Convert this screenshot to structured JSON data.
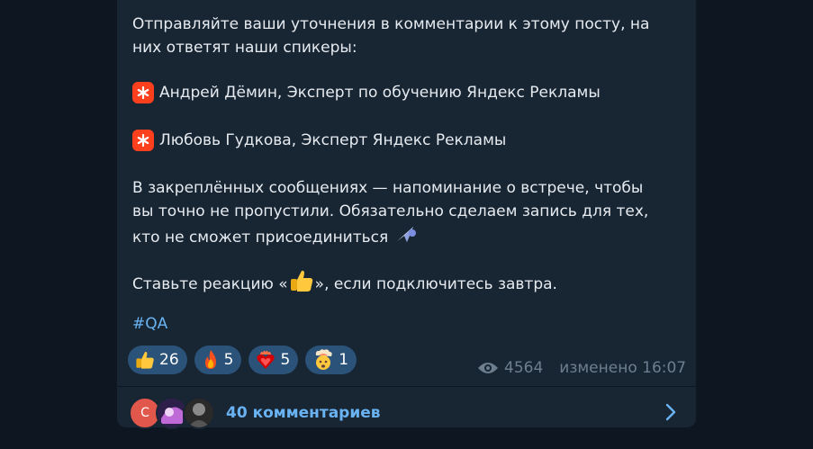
{
  "message": {
    "intro": [
      "Отправляйте ваши уточнения в комментарии к этому посту, на",
      "них ответят наши спикеры:"
    ],
    "speakers": [
      "Андрей Дёмин, Эксперт по обучению Яндекс Рекламы",
      "Любовь Гудкова, Эксперт Яндекс Рекламы"
    ],
    "pinned": [
      "В закреплённых сообщениях — напоминание о встрече, чтобы",
      "вы точно не пропустили. Обязательно сделаем запись для тех,",
      "кто не сможет присоединиться"
    ],
    "reaction_prefix": "Ставьте реакцию «",
    "reaction_suffix": "», если подключитесь завтра.",
    "hashtag": "#QA"
  },
  "reactions": [
    {
      "icon": "thumbs-up-icon",
      "count": "26"
    },
    {
      "icon": "fire-icon",
      "count": "5"
    },
    {
      "icon": "heart-on-fire-icon",
      "count": "5"
    },
    {
      "icon": "exploding-head-icon",
      "count": "1"
    }
  ],
  "meta": {
    "views": "4564",
    "status": "изменено 16:07"
  },
  "comments": {
    "label": "40 комментариев",
    "avatar_initial": "С"
  },
  "colors": {
    "background": "#0e1621",
    "bubble": "#182533",
    "text": "#e6ebf0",
    "link": "#6ab3f3",
    "reaction_chip": "#2b5278",
    "meta": "#6d7f8f",
    "yandex_red": "#fc3f1d"
  }
}
